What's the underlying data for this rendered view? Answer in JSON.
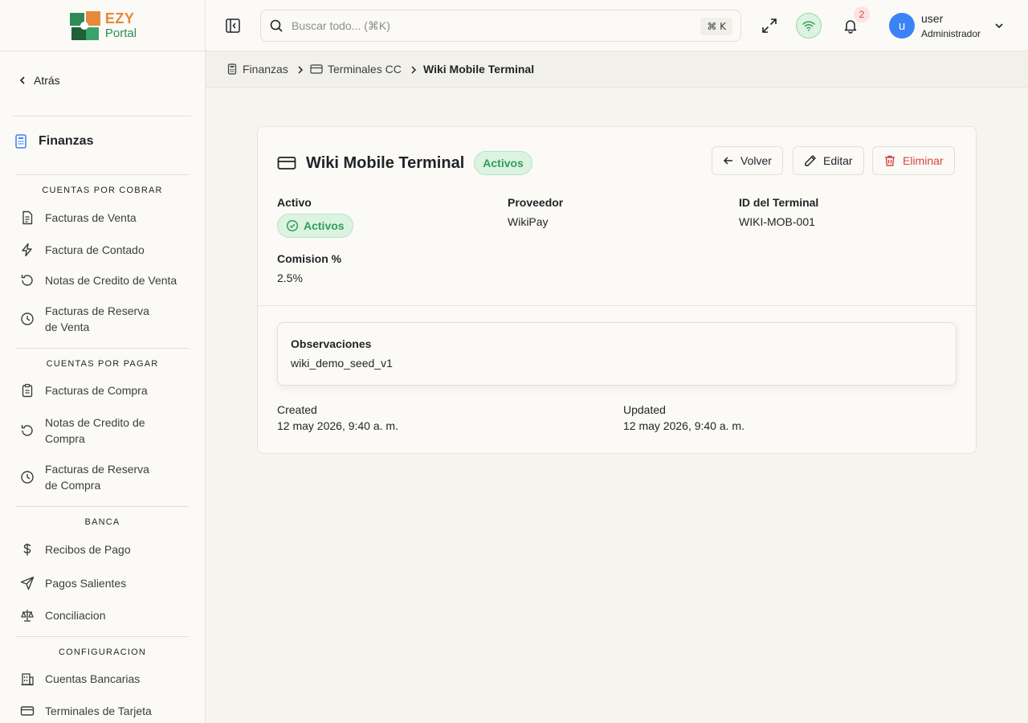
{
  "brand": {
    "line1": "EZY",
    "line2": "Portal"
  },
  "sidebar": {
    "back_label": "Atrás",
    "module_title": "Finanzas",
    "sections": [
      {
        "label": "CUENTAS POR COBRAR",
        "items": [
          "Facturas de Venta",
          "Factura de Contado",
          "Notas de Credito de Venta",
          "Facturas de Reserva de Venta"
        ]
      },
      {
        "label": "CUENTAS POR PAGAR",
        "items": [
          "Facturas de Compra",
          "Notas de Credito de Compra",
          "Facturas de Reserva de Compra"
        ]
      },
      {
        "label": "BANCA",
        "items": [
          "Recibos de Pago",
          "Pagos Salientes",
          "Conciliacion"
        ]
      },
      {
        "label": "CONFIGURACION",
        "items": [
          "Cuentas Bancarias",
          "Terminales de Tarjeta"
        ]
      }
    ]
  },
  "header": {
    "search_placeholder": "Buscar todo... (⌘K)",
    "shortcut": "⌘ K",
    "notification_count": "2",
    "user": {
      "initial": "u",
      "name": "user",
      "role": "Administrador"
    }
  },
  "breadcrumb": [
    "Finanzas",
    "Terminales CC",
    "Wiki Mobile Terminal"
  ],
  "record": {
    "title": "Wiki Mobile Terminal",
    "status": "Activos",
    "actions": {
      "back": "Volver",
      "edit": "Editar",
      "delete": "Eliminar"
    },
    "fields": {
      "active_label": "Activo",
      "active_value": "Activos",
      "provider_label": "Proveedor",
      "provider_value": "WikiPay",
      "terminal_id_label": "ID del Terminal",
      "terminal_id_value": "WIKI-MOB-001",
      "commission_label": "Comision %",
      "commission_value": "2.5%"
    },
    "notes": {
      "label": "Observaciones",
      "value": "wiki_demo_seed_v1"
    },
    "meta": {
      "created_label": "Created",
      "created_value": "12 may 2026, 9:40 a. m.",
      "updated_label": "Updated",
      "updated_value": "12 may 2026, 9:40 a. m."
    }
  },
  "colors": {
    "accent_green": "#2f9e57",
    "danger": "#d64545",
    "avatar": "#3b82f6",
    "brand_orange": "#e58a3c"
  }
}
